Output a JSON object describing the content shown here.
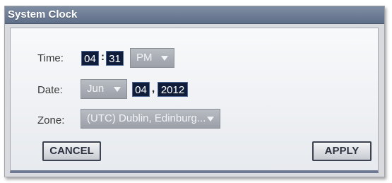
{
  "dialog": {
    "title": "System Clock"
  },
  "time": {
    "label": "Time:",
    "hour": "04",
    "separator": ":",
    "minute": "31",
    "ampm": "PM"
  },
  "date": {
    "label": "Date:",
    "month": "Jun",
    "day": "04",
    "separator": ",",
    "year": "2012"
  },
  "zone": {
    "label": "Zone:",
    "value": "(UTC) Dublin, Edinburg..."
  },
  "buttons": {
    "cancel": "CANCEL",
    "apply": "APPLY"
  },
  "icons": {
    "dropdown_arrow": "chevron-down-icon"
  },
  "colors": {
    "titlebar": "#6b7a93",
    "field_bg": "#0f1c3a",
    "dropdown_bg": "#a9adb5",
    "panel_bg": "#f0f2f5"
  }
}
